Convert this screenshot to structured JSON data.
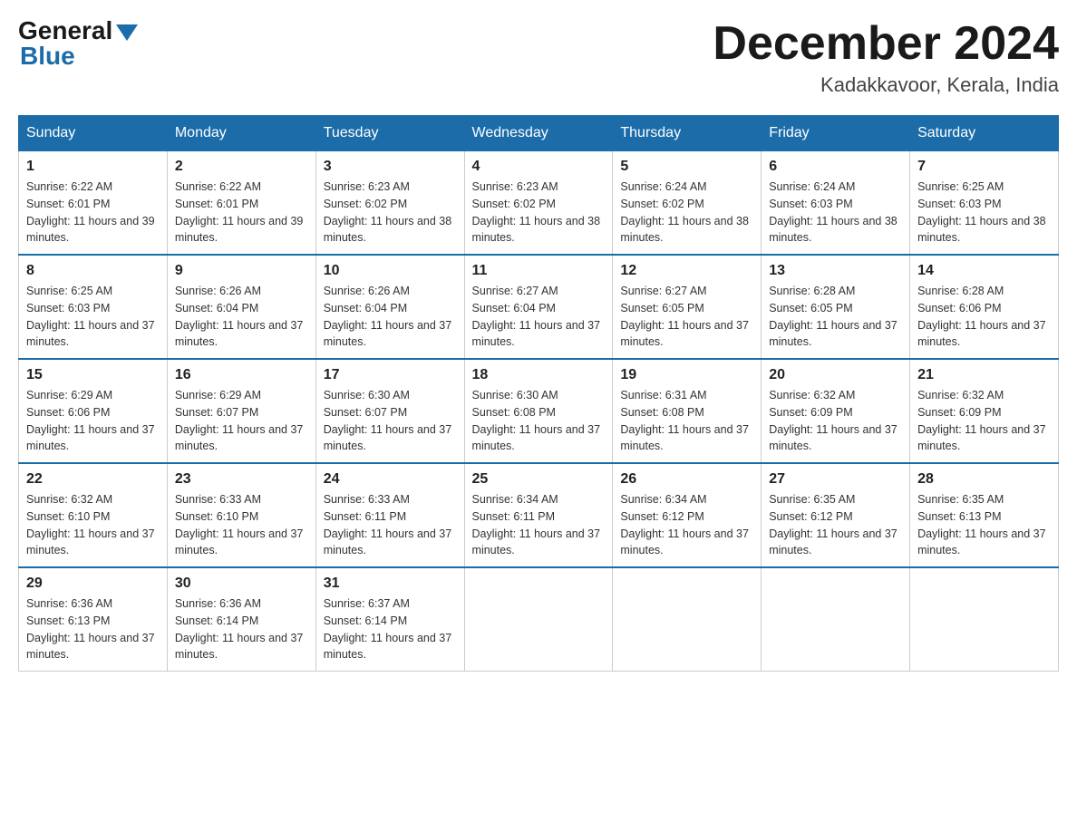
{
  "logo": {
    "general": "General",
    "blue": "Blue"
  },
  "header": {
    "month": "December 2024",
    "location": "Kadakkavoor, Kerala, India"
  },
  "days_of_week": [
    "Sunday",
    "Monday",
    "Tuesday",
    "Wednesday",
    "Thursday",
    "Friday",
    "Saturday"
  ],
  "weeks": [
    [
      {
        "num": "1",
        "sunrise": "6:22 AM",
        "sunset": "6:01 PM",
        "daylight": "11 hours and 39 minutes."
      },
      {
        "num": "2",
        "sunrise": "6:22 AM",
        "sunset": "6:01 PM",
        "daylight": "11 hours and 39 minutes."
      },
      {
        "num": "3",
        "sunrise": "6:23 AM",
        "sunset": "6:02 PM",
        "daylight": "11 hours and 38 minutes."
      },
      {
        "num": "4",
        "sunrise": "6:23 AM",
        "sunset": "6:02 PM",
        "daylight": "11 hours and 38 minutes."
      },
      {
        "num": "5",
        "sunrise": "6:24 AM",
        "sunset": "6:02 PM",
        "daylight": "11 hours and 38 minutes."
      },
      {
        "num": "6",
        "sunrise": "6:24 AM",
        "sunset": "6:03 PM",
        "daylight": "11 hours and 38 minutes."
      },
      {
        "num": "7",
        "sunrise": "6:25 AM",
        "sunset": "6:03 PM",
        "daylight": "11 hours and 38 minutes."
      }
    ],
    [
      {
        "num": "8",
        "sunrise": "6:25 AM",
        "sunset": "6:03 PM",
        "daylight": "11 hours and 37 minutes."
      },
      {
        "num": "9",
        "sunrise": "6:26 AM",
        "sunset": "6:04 PM",
        "daylight": "11 hours and 37 minutes."
      },
      {
        "num": "10",
        "sunrise": "6:26 AM",
        "sunset": "6:04 PM",
        "daylight": "11 hours and 37 minutes."
      },
      {
        "num": "11",
        "sunrise": "6:27 AM",
        "sunset": "6:04 PM",
        "daylight": "11 hours and 37 minutes."
      },
      {
        "num": "12",
        "sunrise": "6:27 AM",
        "sunset": "6:05 PM",
        "daylight": "11 hours and 37 minutes."
      },
      {
        "num": "13",
        "sunrise": "6:28 AM",
        "sunset": "6:05 PM",
        "daylight": "11 hours and 37 minutes."
      },
      {
        "num": "14",
        "sunrise": "6:28 AM",
        "sunset": "6:06 PM",
        "daylight": "11 hours and 37 minutes."
      }
    ],
    [
      {
        "num": "15",
        "sunrise": "6:29 AM",
        "sunset": "6:06 PM",
        "daylight": "11 hours and 37 minutes."
      },
      {
        "num": "16",
        "sunrise": "6:29 AM",
        "sunset": "6:07 PM",
        "daylight": "11 hours and 37 minutes."
      },
      {
        "num": "17",
        "sunrise": "6:30 AM",
        "sunset": "6:07 PM",
        "daylight": "11 hours and 37 minutes."
      },
      {
        "num": "18",
        "sunrise": "6:30 AM",
        "sunset": "6:08 PM",
        "daylight": "11 hours and 37 minutes."
      },
      {
        "num": "19",
        "sunrise": "6:31 AM",
        "sunset": "6:08 PM",
        "daylight": "11 hours and 37 minutes."
      },
      {
        "num": "20",
        "sunrise": "6:32 AM",
        "sunset": "6:09 PM",
        "daylight": "11 hours and 37 minutes."
      },
      {
        "num": "21",
        "sunrise": "6:32 AM",
        "sunset": "6:09 PM",
        "daylight": "11 hours and 37 minutes."
      }
    ],
    [
      {
        "num": "22",
        "sunrise": "6:32 AM",
        "sunset": "6:10 PM",
        "daylight": "11 hours and 37 minutes."
      },
      {
        "num": "23",
        "sunrise": "6:33 AM",
        "sunset": "6:10 PM",
        "daylight": "11 hours and 37 minutes."
      },
      {
        "num": "24",
        "sunrise": "6:33 AM",
        "sunset": "6:11 PM",
        "daylight": "11 hours and 37 minutes."
      },
      {
        "num": "25",
        "sunrise": "6:34 AM",
        "sunset": "6:11 PM",
        "daylight": "11 hours and 37 minutes."
      },
      {
        "num": "26",
        "sunrise": "6:34 AM",
        "sunset": "6:12 PM",
        "daylight": "11 hours and 37 minutes."
      },
      {
        "num": "27",
        "sunrise": "6:35 AM",
        "sunset": "6:12 PM",
        "daylight": "11 hours and 37 minutes."
      },
      {
        "num": "28",
        "sunrise": "6:35 AM",
        "sunset": "6:13 PM",
        "daylight": "11 hours and 37 minutes."
      }
    ],
    [
      {
        "num": "29",
        "sunrise": "6:36 AM",
        "sunset": "6:13 PM",
        "daylight": "11 hours and 37 minutes."
      },
      {
        "num": "30",
        "sunrise": "6:36 AM",
        "sunset": "6:14 PM",
        "daylight": "11 hours and 37 minutes."
      },
      {
        "num": "31",
        "sunrise": "6:37 AM",
        "sunset": "6:14 PM",
        "daylight": "11 hours and 37 minutes."
      },
      null,
      null,
      null,
      null
    ]
  ],
  "labels": {
    "sunrise": "Sunrise:",
    "sunset": "Sunset:",
    "daylight": "Daylight:"
  }
}
